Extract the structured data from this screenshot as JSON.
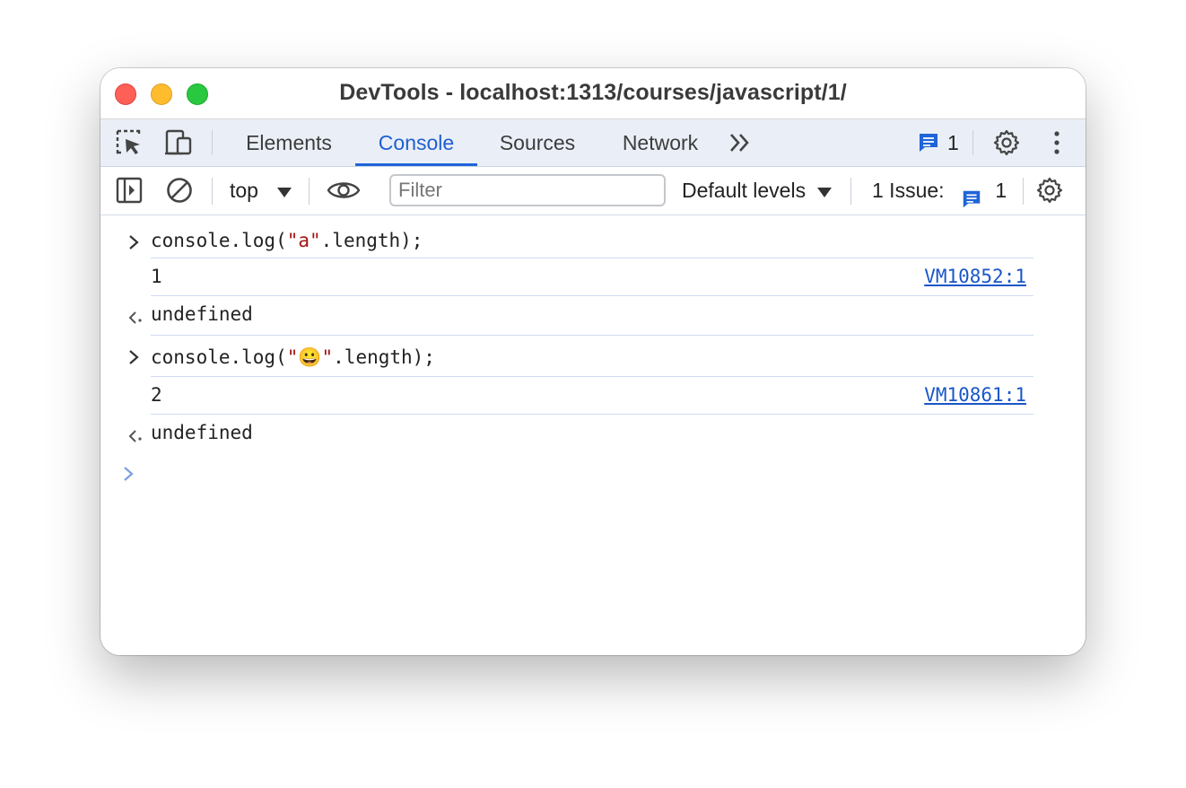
{
  "window": {
    "title": "DevTools - localhost:1313/courses/javascript/1/"
  },
  "tabbar": {
    "tabs": [
      {
        "label": "Elements",
        "active": false
      },
      {
        "label": "Console",
        "active": true
      },
      {
        "label": "Sources",
        "active": false
      },
      {
        "label": "Network",
        "active": false
      }
    ],
    "more_icon": "double-chevron-right-icon",
    "message_count": "1"
  },
  "toolbar": {
    "context": "top",
    "filter_placeholder": "Filter",
    "levels": "Default levels",
    "issues_label": "1 Issue:",
    "issues_count": "1"
  },
  "console": {
    "entries": [
      {
        "kind": "input",
        "pre": "console.log(",
        "str": "\"a\"",
        "post": ".length);"
      },
      {
        "kind": "log",
        "value": "1",
        "source": "VM10852:1"
      },
      {
        "kind": "result",
        "value": "undefined"
      },
      {
        "kind": "input",
        "pre": "console.log(",
        "str": "\"😀\"",
        "post": ".length);"
      },
      {
        "kind": "log",
        "value": "2",
        "source": "VM10861:1"
      },
      {
        "kind": "result",
        "value": "undefined"
      }
    ]
  },
  "colors": {
    "accent": "#1f64d8",
    "string": "#a31515",
    "number": "#1a1aa6",
    "undefined": "#7a7a7a",
    "link": "#1a56c8"
  }
}
